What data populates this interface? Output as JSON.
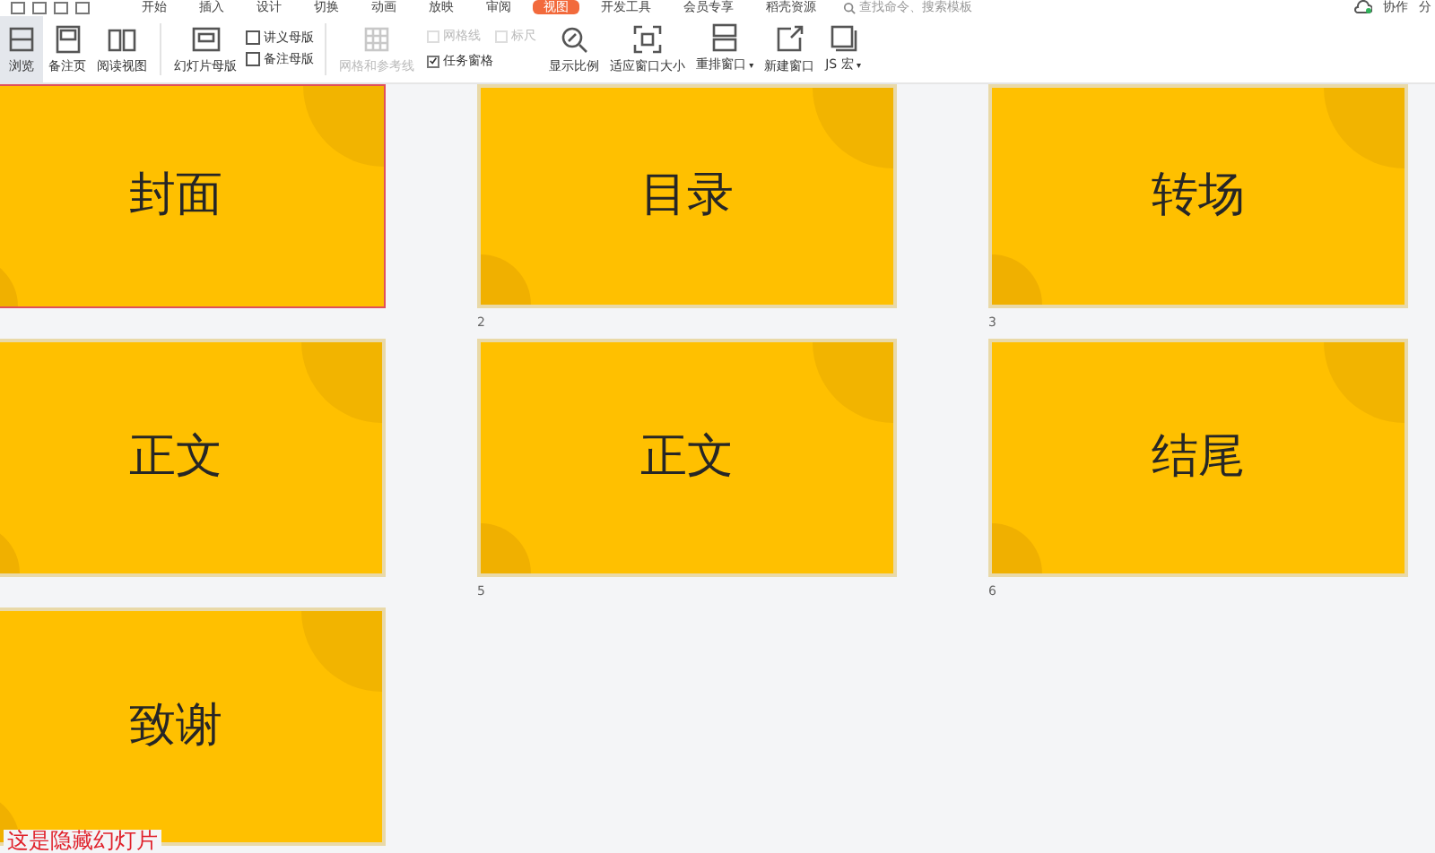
{
  "menu_tabs": [
    {
      "label": "开始",
      "selected": false
    },
    {
      "label": "插入",
      "selected": false
    },
    {
      "label": "设计",
      "selected": false
    },
    {
      "label": "切换",
      "selected": false
    },
    {
      "label": "动画",
      "selected": false
    },
    {
      "label": "放映",
      "selected": false
    },
    {
      "label": "审阅",
      "selected": false
    },
    {
      "label": "视图",
      "selected": true
    },
    {
      "label": "开发工具",
      "selected": false
    },
    {
      "label": "会员专享",
      "selected": false
    },
    {
      "label": "稻壳资源",
      "selected": false
    }
  ],
  "search": {
    "placeholder": "查找命令、搜索模板"
  },
  "top_right": [
    "协作",
    "分"
  ],
  "ribbon": [
    {
      "kind": "large",
      "label": "浏览",
      "selected": true,
      "disabled": false
    },
    {
      "kind": "large",
      "label": "备注页",
      "selected": false,
      "disabled": false
    },
    {
      "kind": "large",
      "label": "阅读视图",
      "selected": false,
      "disabled": false
    },
    {
      "kind": "separator"
    },
    {
      "kind": "large",
      "label": "幻灯片母版",
      "selected": false,
      "disabled": false
    },
    {
      "kind": "stack",
      "items": [
        {
          "label": "讲义母版"
        },
        {
          "label": "备注母版"
        }
      ]
    },
    {
      "kind": "separator"
    },
    {
      "kind": "large",
      "label": "网格和参考线",
      "selected": false,
      "disabled": true
    },
    {
      "kind": "checks",
      "rows": [
        [
          {
            "label": "网格线",
            "checked": false,
            "disabled": true
          },
          {
            "label": "标尺",
            "checked": false,
            "disabled": true
          }
        ],
        [
          {
            "label": "任务窗格",
            "checked": true,
            "disabled": false
          }
        ]
      ]
    },
    {
      "kind": "large",
      "label": "显示比例",
      "selected": false,
      "disabled": false
    },
    {
      "kind": "large",
      "label": "适应窗口大小",
      "selected": false,
      "disabled": false
    },
    {
      "kind": "large",
      "label": "重排窗口",
      "caret": "▾",
      "selected": false,
      "disabled": false
    },
    {
      "kind": "large",
      "label": "新建窗口",
      "selected": false,
      "disabled": false
    },
    {
      "kind": "large",
      "label": "JS 宏",
      "caret": "▾",
      "selected": false,
      "disabled": false
    }
  ],
  "slides": [
    {
      "title": "封面",
      "selected": true
    },
    {
      "title": "目录",
      "number": "2",
      "selected": false
    },
    {
      "title": "转场",
      "number": "3",
      "selected": false
    },
    {
      "title": "正文",
      "selected": false
    },
    {
      "title": "正文",
      "number": "5",
      "selected": false
    },
    {
      "title": "结尾",
      "number": "6",
      "selected": false
    },
    {
      "title": "致谢",
      "selected": false
    }
  ],
  "note": "这是隐藏幻灯片"
}
